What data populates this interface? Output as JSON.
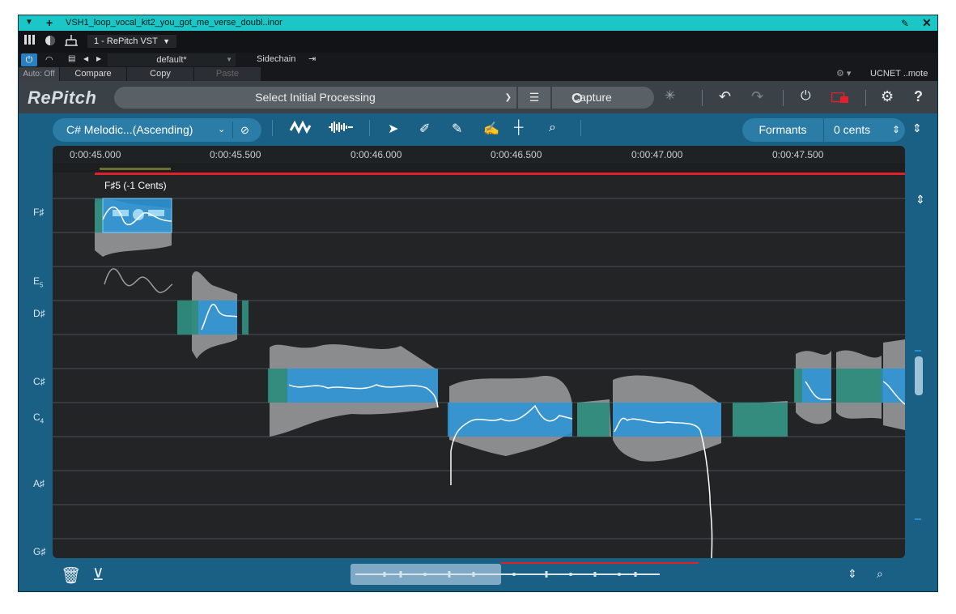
{
  "window": {
    "title": "VSH1_loop_vocal_kit2_you_got_me_verse_doubl..inor",
    "menu_icon": "triangle-down-icon",
    "add_icon": "plus-icon",
    "pin_icon": "pin-icon",
    "close_icon": "close-icon"
  },
  "host": {
    "plugin_slot": "1 - RePitch VST",
    "preset": "default*",
    "sidechain_label": "Sidechain",
    "auto_label": "Auto: Off",
    "compare_label": "Compare",
    "copy_label": "Copy",
    "paste_label": "Paste",
    "remote_label": "UCNET ..mote"
  },
  "header": {
    "logo": "RePitch",
    "processing_select": "Select Initial Processing",
    "capture_label": "Capture"
  },
  "toolbar": {
    "scale_select": "C# Melodic...(Ascending)",
    "formants_label": "Formants",
    "cents_value": "0 cents"
  },
  "timeline": {
    "ticks": [
      "0:00:45.000",
      "0:00:45.500",
      "0:00:46.000",
      "0:00:46.500",
      "0:00:47.000",
      "0:00:47.500"
    ]
  },
  "note_labels": {
    "fs5": "F♯",
    "e5_main": "E",
    "e5_sub": "5",
    "ds": "D♯",
    "cs": "C♯",
    "c4_main": "C",
    "c4_sub": "4",
    "as": "A♯",
    "gs": "G♯"
  },
  "selected_note_tooltip": "F♯5 (-1 Cents)",
  "colors": {
    "accent": "#2b7ca7",
    "note_fill": "#2f95d6",
    "note_teal": "#2f8c7e",
    "playhead_red": "#e0202a",
    "title_bar": "#1bc6c6"
  }
}
